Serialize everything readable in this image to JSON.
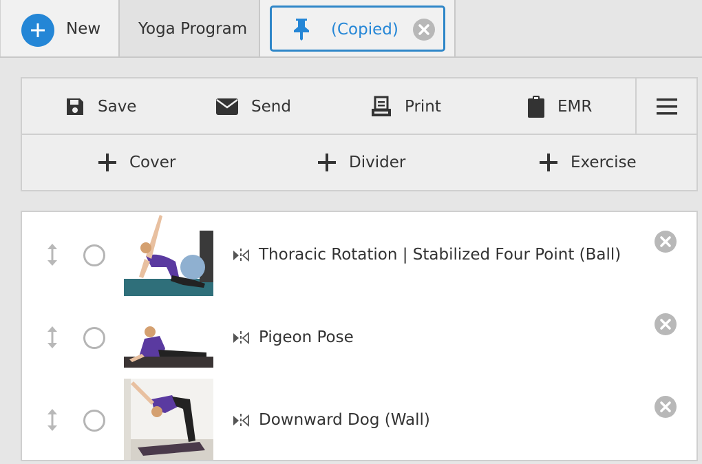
{
  "tabs": {
    "new_label": "New",
    "program_label": "Yoga Program",
    "copied_label": "(Copied)"
  },
  "toolbar": {
    "save_label": "Save",
    "send_label": "Send",
    "print_label": "Print",
    "emr_label": "EMR",
    "add_cover_label": "Cover",
    "add_divider_label": "Divider",
    "add_exercise_label": "Exercise"
  },
  "exercises": [
    {
      "title": "Thoracic Rotation | Stabilized Four Point (Ball)",
      "selected": false
    },
    {
      "title": "Pigeon Pose",
      "selected": false
    },
    {
      "title": "Downward Dog (Wall)",
      "selected": false
    }
  ],
  "colors": {
    "accent": "#2486d6",
    "tab_border": "#2e86c8",
    "icon_gray": "#b8b8b8",
    "text": "#333333"
  },
  "icons": [
    "plus-circle-icon",
    "pin-icon",
    "close-circle-icon",
    "save-icon",
    "envelope-icon",
    "print-icon",
    "clipboard-icon",
    "hamburger-menu-icon",
    "plus-icon",
    "drag-handle-icon",
    "mirror-icon"
  ]
}
